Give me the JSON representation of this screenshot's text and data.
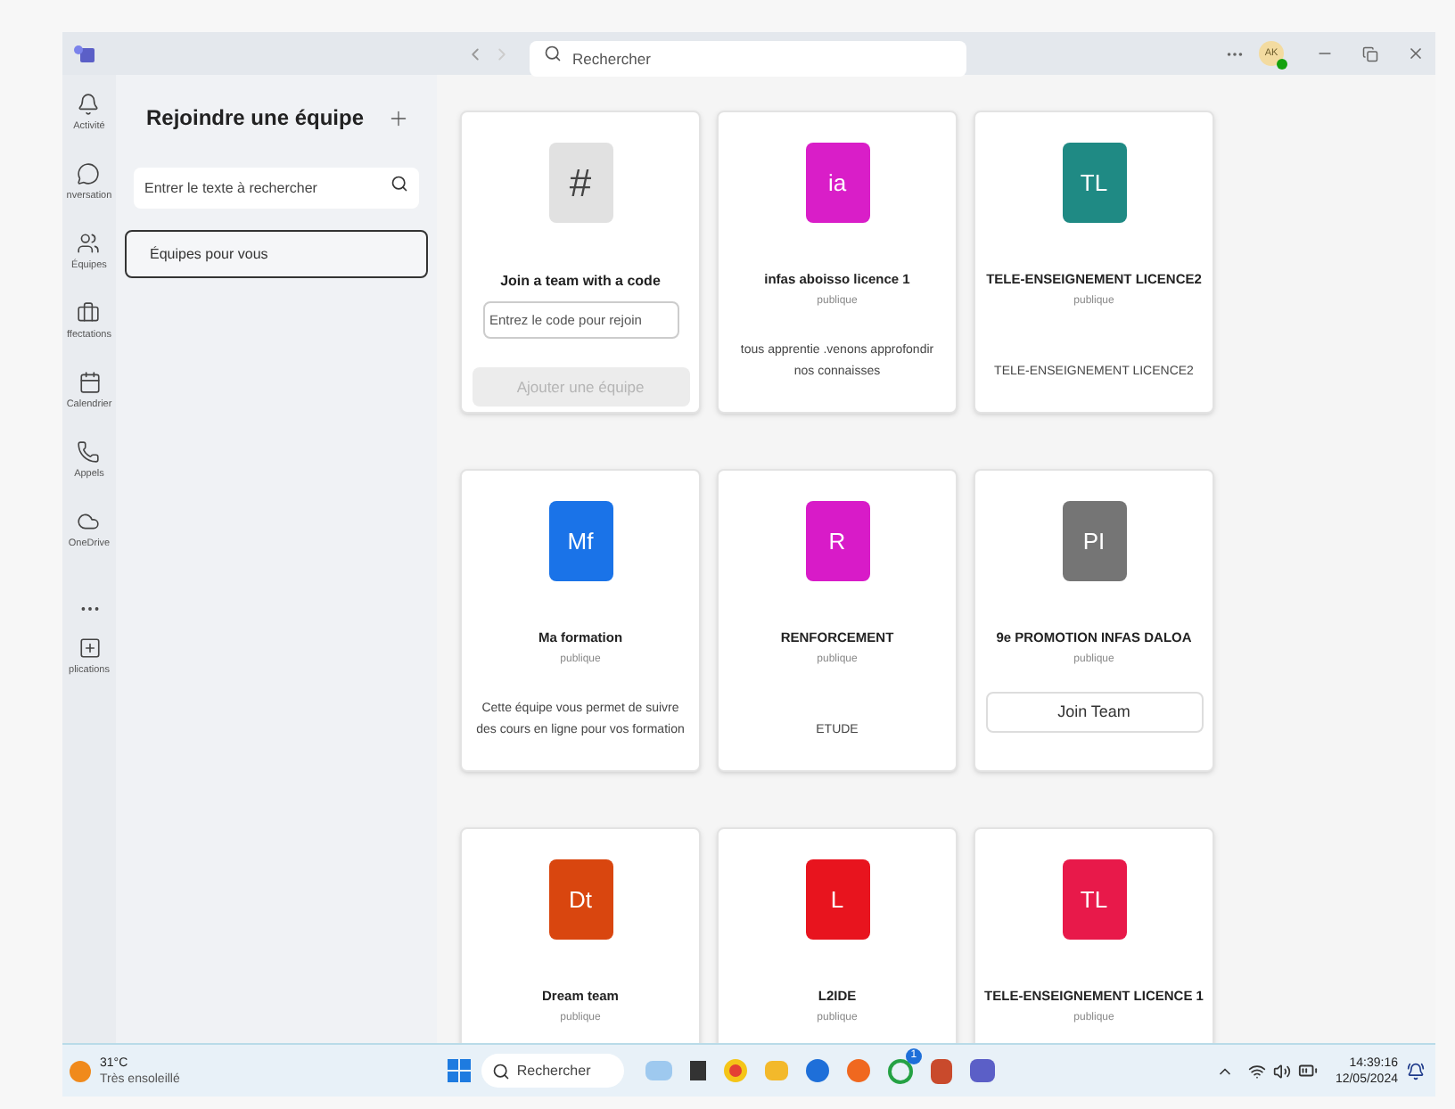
{
  "title_bar": {
    "search_placeholder": "Rechercher",
    "avatar_initials": "AK"
  },
  "rail": [
    {
      "kind": "app",
      "label": "Activité"
    },
    {
      "kind": "app",
      "label": "nversation"
    },
    {
      "kind": "app",
      "label": "Équipes"
    },
    {
      "kind": "app",
      "label": "ffectations"
    },
    {
      "kind": "app",
      "label": "Calendrier"
    },
    {
      "kind": "app",
      "label": "Appels"
    },
    {
      "kind": "app",
      "label": "OneDrive"
    },
    {
      "kind": "more"
    },
    {
      "kind": "app",
      "label": "plications"
    }
  ],
  "panel": {
    "title": "Rejoindre une équipe",
    "search_placeholder": "Entrer le texte à rechercher",
    "items": [
      {
        "label": "Équipes pour vous",
        "selected": true
      }
    ]
  },
  "cards": [
    {
      "kind": "code",
      "symbol": "#",
      "title": "Join a team with a code",
      "placeholder": "Entrez le code pour rejoin",
      "button": "Ajouter une équipe"
    },
    {
      "kind": "team",
      "initials": "ia",
      "color": "#d91ec8",
      "name": "infas aboisso licence 1",
      "visibility": "publique",
      "description": "tous apprentie .venons approfondir nos connaisses"
    },
    {
      "kind": "team",
      "initials": "TL",
      "color": "#1f8a84",
      "name": "TELE-ENSEIGNEMENT LICENCE2",
      "visibility": "publique",
      "description": "TELE-ENSEIGNEMENT LICENCE2"
    },
    {
      "kind": "team",
      "initials": "Mf",
      "color": "#1a73e8",
      "name": "Ma formation",
      "visibility": "publique",
      "description": "Cette équipe vous permet de suivre des cours en ligne pour vos formation"
    },
    {
      "kind": "team",
      "initials": "R",
      "color": "#d81bc8",
      "name": "RENFORCEMENT",
      "visibility": "publique",
      "description": "ETUDE"
    },
    {
      "kind": "join",
      "initials": "PI",
      "color": "#757575",
      "name": "9e PROMOTION INFAS DALOA",
      "visibility": "publique",
      "button": "Join Team"
    },
    {
      "kind": "team",
      "initials": "Dt",
      "color": "#d9460f",
      "name": "Dream team",
      "visibility": "publique"
    },
    {
      "kind": "team",
      "initials": "L",
      "color": "#e8141e",
      "name": "L2IDE",
      "visibility": "publique"
    },
    {
      "kind": "team",
      "initials": "TL",
      "color": "#e8194a",
      "name": "TELE-ENSEIGNEMENT LICENCE 1",
      "visibility": "publique"
    }
  ],
  "taskbar": {
    "temperature": "31°C",
    "weather": "Très ensoleillé",
    "search": "Rechercher",
    "whatsapp_badge": "1",
    "time": "14:39:16",
    "date": "12/05/2024"
  }
}
